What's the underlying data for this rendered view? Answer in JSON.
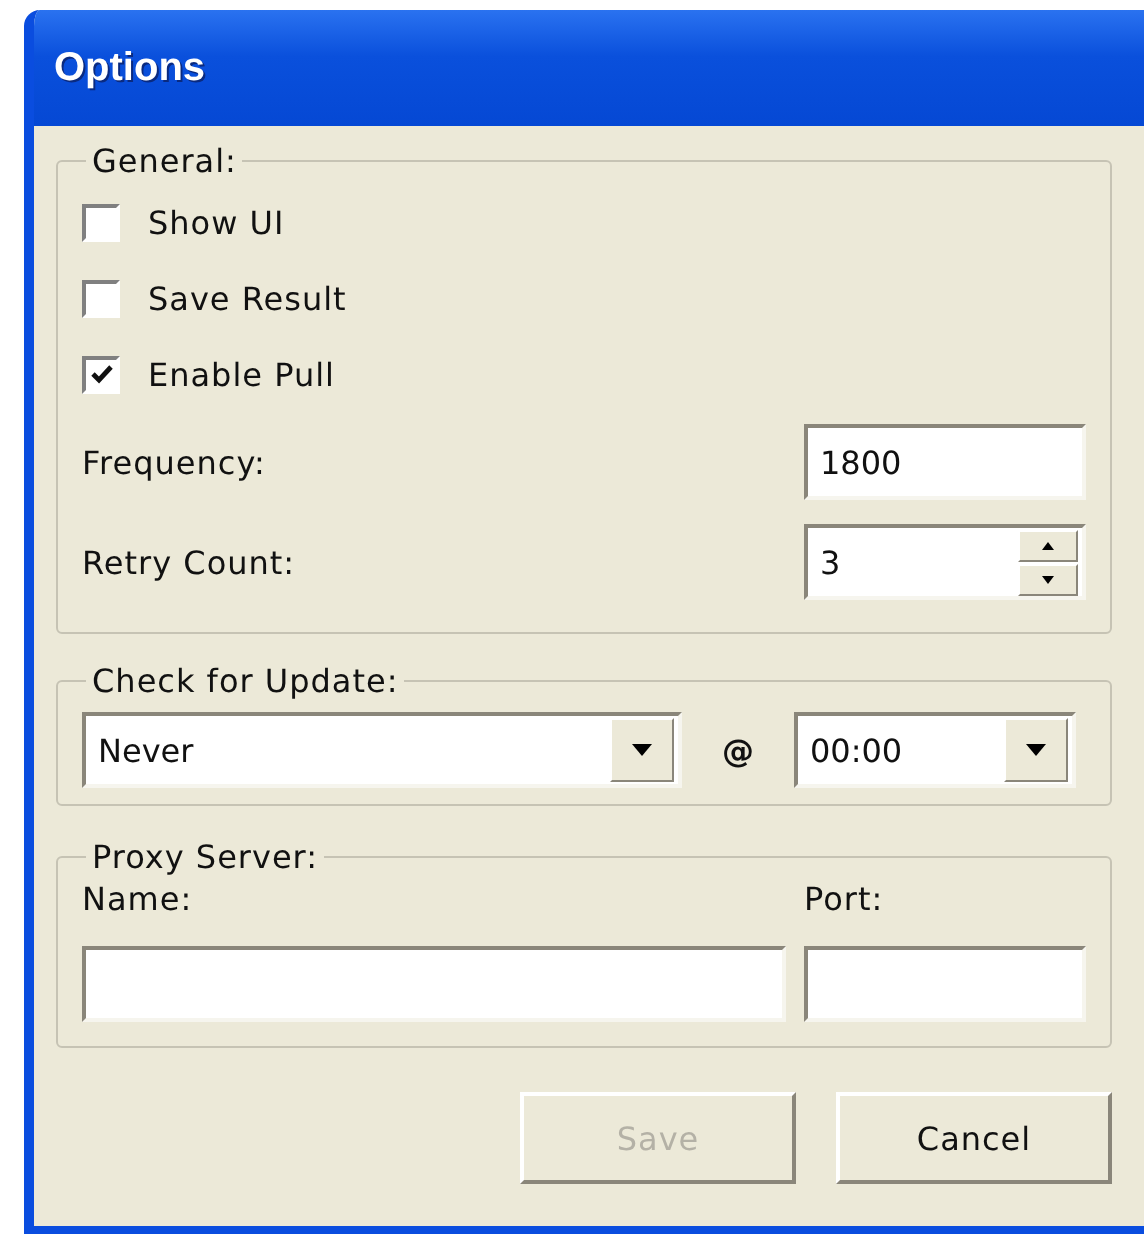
{
  "window": {
    "title": "Options"
  },
  "general": {
    "legend": "General:",
    "checkboxes": [
      {
        "label": "Show UI",
        "checked": false
      },
      {
        "label": "Save Result",
        "checked": false
      },
      {
        "label": "Enable Pull",
        "checked": true
      }
    ],
    "fields": [
      {
        "kind": "text",
        "label": "Frequency:",
        "value": "1800"
      },
      {
        "kind": "spin",
        "label": "Retry Count:",
        "value": "3"
      }
    ]
  },
  "update": {
    "legend": "Check for Update:",
    "frequency": "Never",
    "at": "@",
    "time": "00:00"
  },
  "proxy": {
    "legend": "Proxy Server:",
    "name_label": "Name:",
    "port_label": "Port:"
  },
  "buttons": [
    {
      "label": "Save",
      "disabled": true
    },
    {
      "label": "Cancel",
      "disabled": false
    }
  ]
}
